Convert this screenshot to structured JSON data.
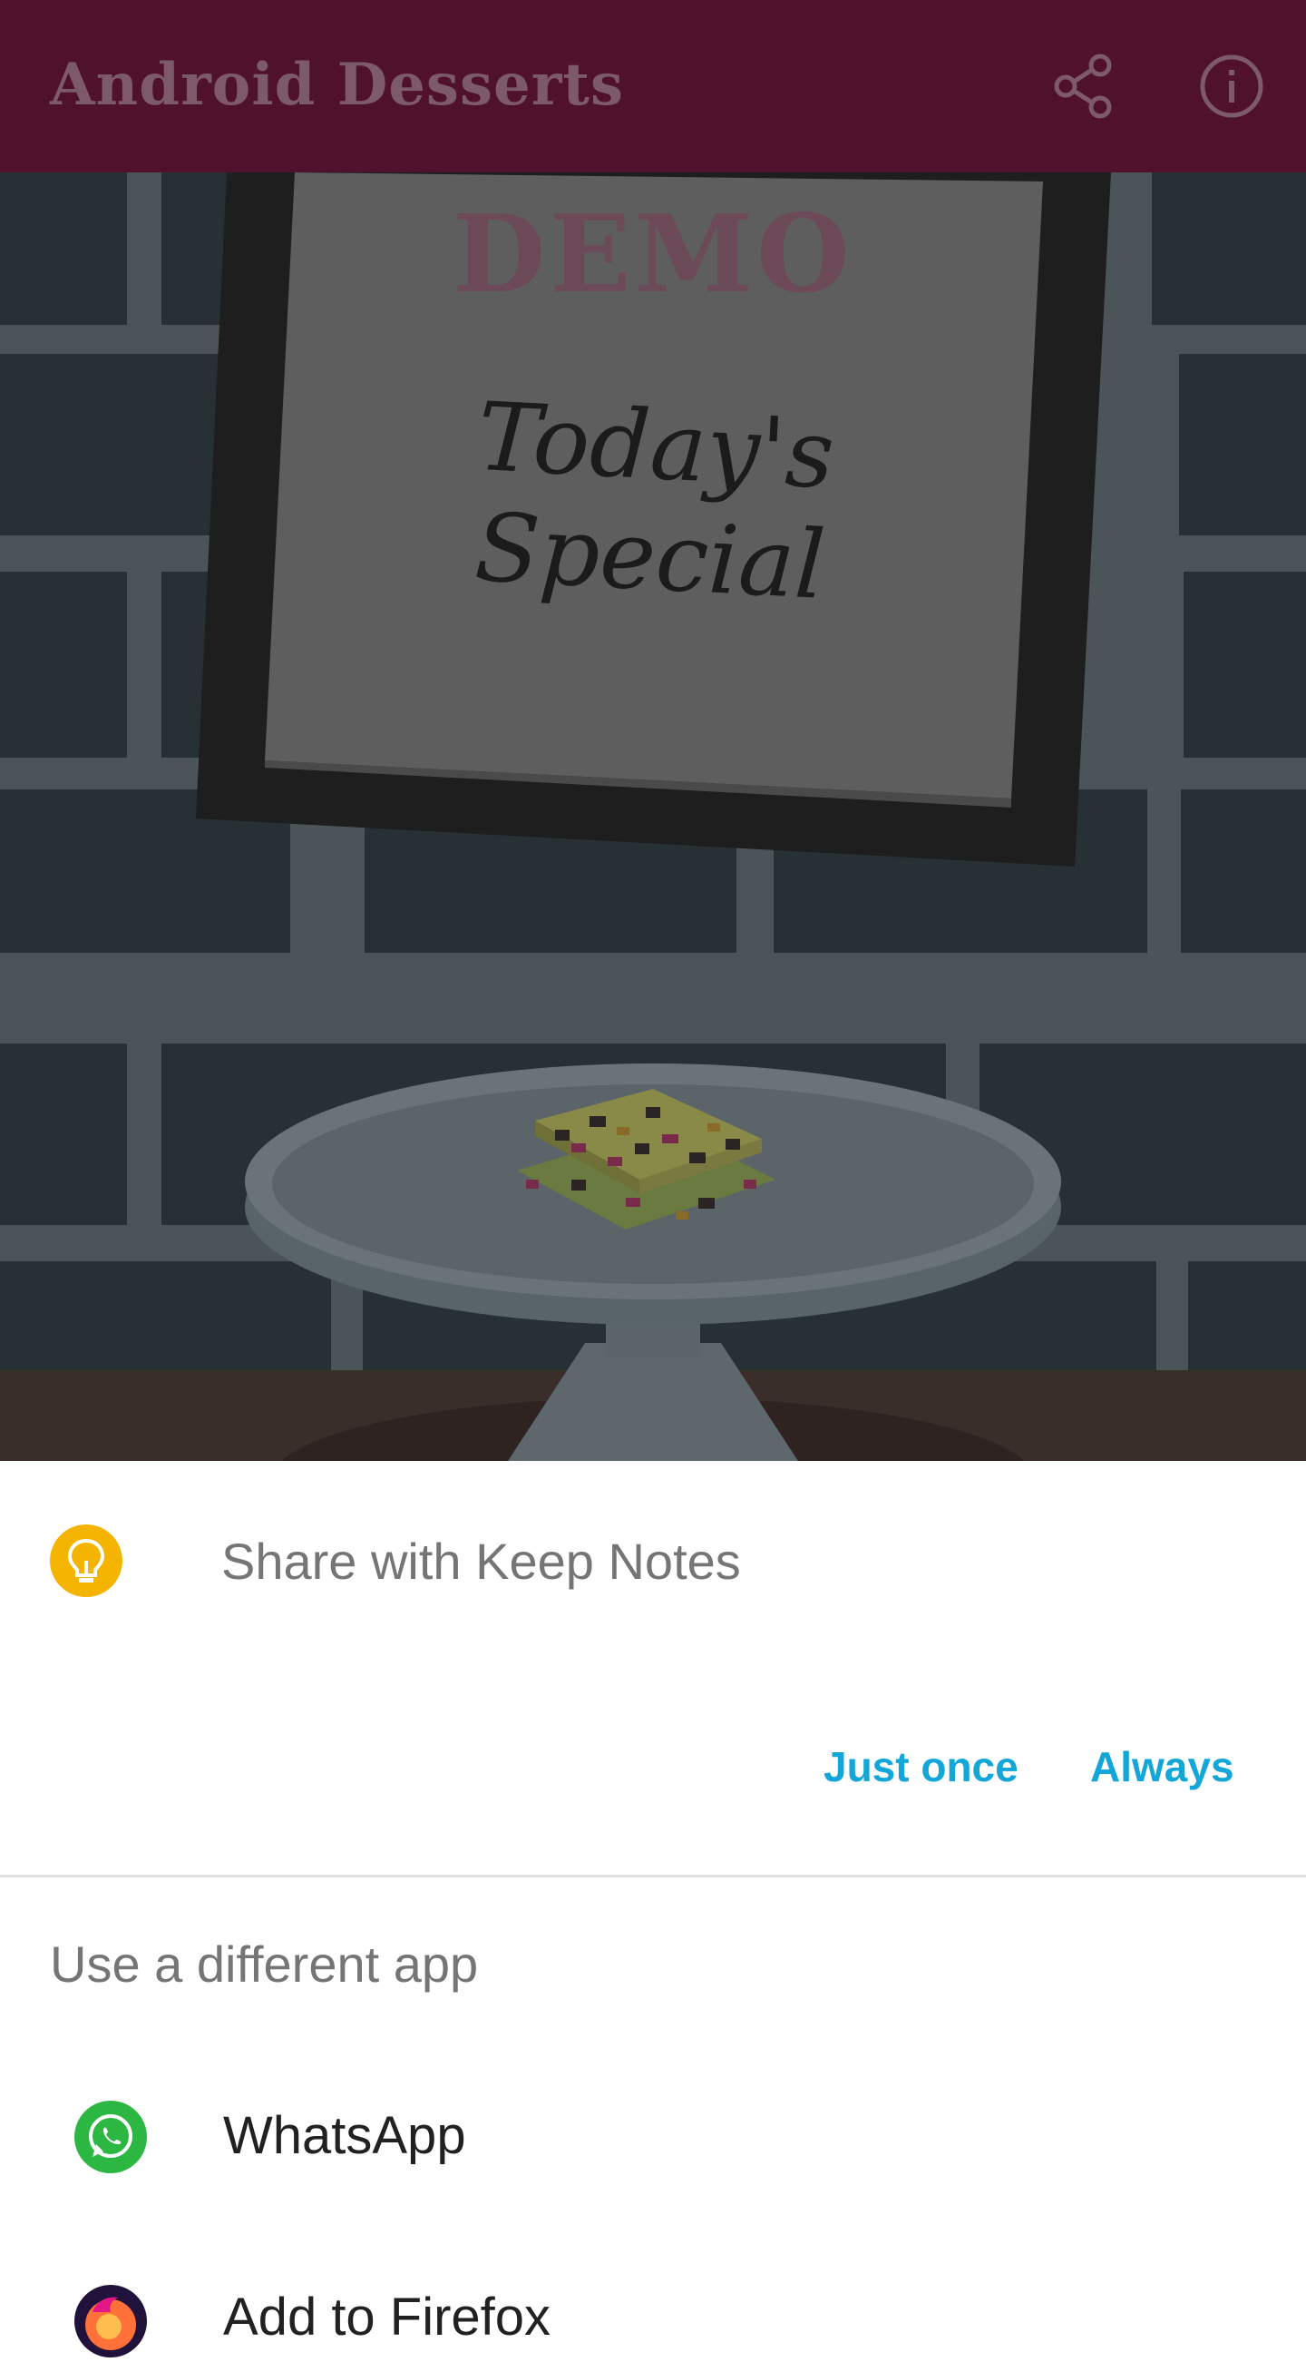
{
  "app_bar": {
    "title": "Android Desserts",
    "share_icon": "share-icon",
    "info_icon": "info-icon",
    "background": "#50112d"
  },
  "scene": {
    "watermark": "DEMO",
    "sign_text": "Today's Special"
  },
  "share_sheet": {
    "default_app": {
      "title": "Share with Keep Notes",
      "icon": "keep-notes-icon",
      "icon_color": "#f5b400"
    },
    "buttons": {
      "just_once": "Just once",
      "always": "Always",
      "accent": "#12a6d9"
    },
    "other_header": "Use a different app",
    "apps": [
      {
        "label": "WhatsApp",
        "icon": "whatsapp-icon"
      },
      {
        "label": "Add to Firefox",
        "icon": "firefox-icon"
      }
    ]
  }
}
